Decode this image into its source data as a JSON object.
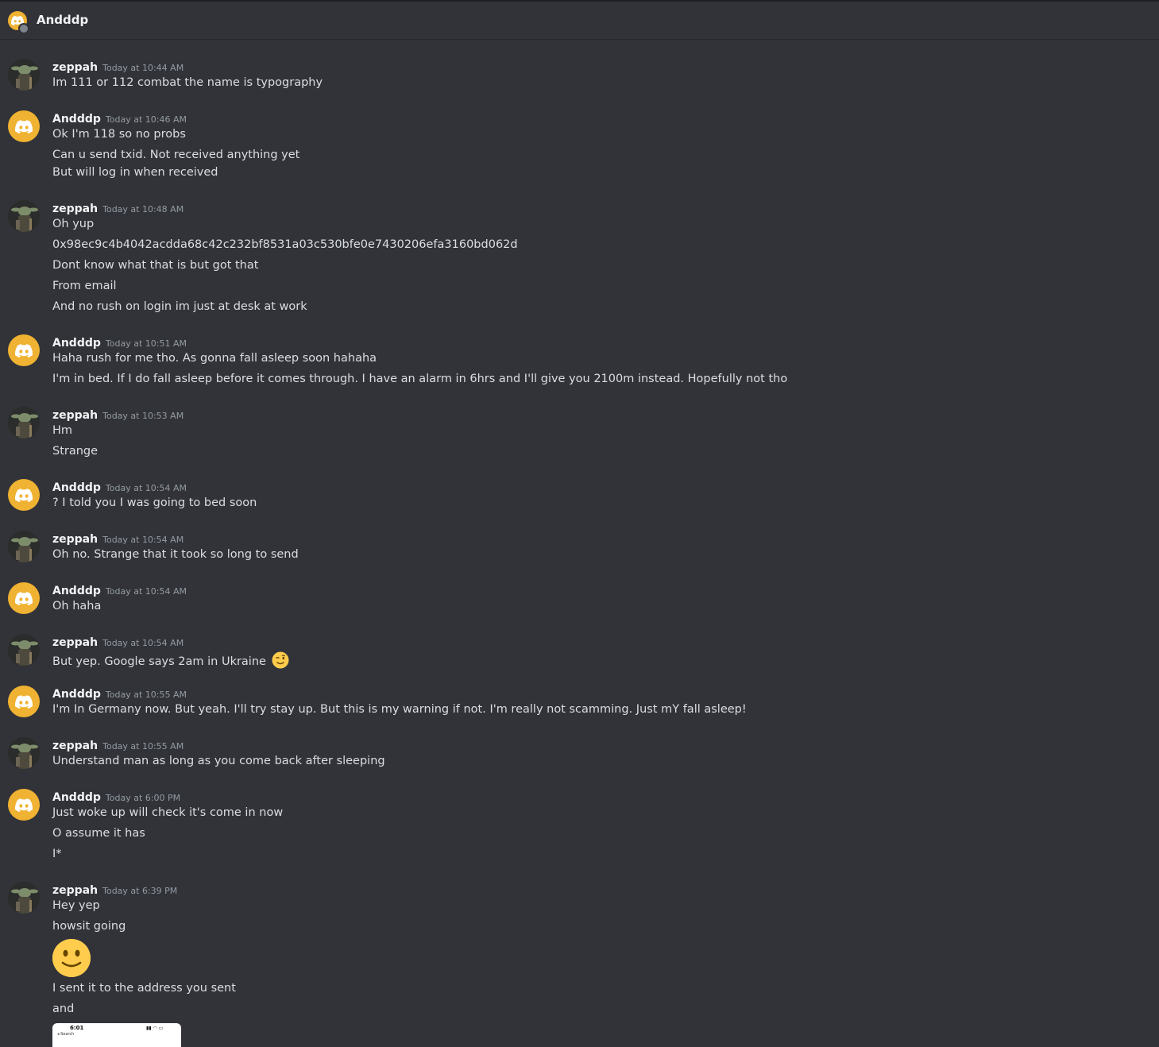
{
  "header": {
    "title": "Andddp"
  },
  "messages": [
    {
      "author": "zeppah",
      "time": "Today at 10:44 AM",
      "lines": [
        "Im 111 or 112 combat the name is typography"
      ]
    },
    {
      "author": "Andddp",
      "time": "Today at 10:46 AM",
      "lines": [
        "Ok I'm 118 so no probs",
        "Can u send txid. Not received anything yet",
        "But will log in when received"
      ]
    },
    {
      "author": "zeppah",
      "time": "Today at 10:48 AM",
      "lines": [
        "Oh yup",
        "0x98ec9c4b4042acdda68c42c232bf8531a03c530bfe0e7430206efa3160bd062d",
        "Dont know what that is but got that",
        "From email",
        "And no rush on login im just at desk at work"
      ]
    },
    {
      "author": "Andddp",
      "time": "Today at 10:51 AM",
      "lines": [
        "Haha rush for me tho. As gonna fall asleep soon hahaha",
        "I'm in bed. If I do fall asleep before it comes through. I have an alarm in 6hrs and I'll give you 2100m instead. Hopefully not tho"
      ]
    },
    {
      "author": "zeppah",
      "time": "Today at 10:53 AM",
      "lines": [
        "Hm",
        "Strange"
      ]
    },
    {
      "author": "Andddp",
      "time": "Today at 10:54 AM",
      "lines": [
        "? I told you I was going to bed soon"
      ]
    },
    {
      "author": "zeppah",
      "time": "Today at 10:54 AM",
      "lines": [
        "Oh no. Strange that it took so long to send"
      ]
    },
    {
      "author": "Andddp",
      "time": "Today at 10:54 AM",
      "lines": [
        "Oh haha"
      ]
    },
    {
      "author": "zeppah",
      "time": "Today at 10:54 AM",
      "lines": [
        "But yep. Google says 2am in Ukraine"
      ]
    },
    {
      "author": "Andddp",
      "time": "Today at 10:55 AM",
      "lines": [
        "I'm In Germany now. But yeah. I'll try stay up. But this is my warning if not. I'm really not scamming. Just mY fall asleep!"
      ]
    },
    {
      "author": "zeppah",
      "time": "Today at 10:55 AM",
      "lines": [
        "Understand man as long as you come back after sleeping"
      ]
    },
    {
      "author": "Andddp",
      "time": "Today at 6:00 PM",
      "lines": [
        "Just woke up will check it's come in now",
        "O assume it has",
        "I*"
      ]
    },
    {
      "author": "zeppah",
      "time": "Today at 6:39 PM",
      "lines": [
        "Hey yep",
        "howsit going",
        "I sent it to the address you sent",
        "and"
      ]
    }
  ],
  "attachment": {
    "time": "6:01",
    "back_label": "◂ Search"
  },
  "icons": {
    "dm_avatar": "discord-logo-icon",
    "emoji_wink": "winking-face-icon",
    "emoji_smile": "slightly-smiling-face-icon"
  },
  "colors": {
    "background": "#313338",
    "discord_avatar": "#f0b232",
    "username": "#f2f3f5",
    "timestamp": "#949ba4",
    "text": "#dbdee1"
  }
}
